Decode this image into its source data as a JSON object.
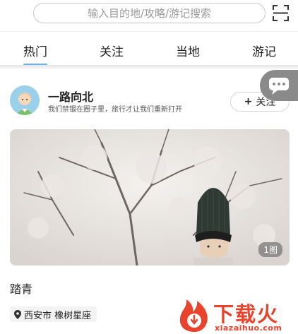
{
  "search": {
    "placeholder": "输入目的地/攻略/游记搜索",
    "icon": "scan-icon"
  },
  "tabs": [
    {
      "label": "热门",
      "active": true
    },
    {
      "label": "关注",
      "active": false
    },
    {
      "label": "当地",
      "active": false
    },
    {
      "label": "游记",
      "active": false
    }
  ],
  "post": {
    "username": "一路向北",
    "signature": "我们禁锢在圈子里，旅行才让我们重新打开",
    "follow_label": "关注",
    "follow_plus": "+",
    "image_count": "1图",
    "title": "踏青",
    "location": "西安市 橡树星座"
  },
  "watermark": {
    "title": "下载火",
    "subtitle": "xiazaihuo.com"
  },
  "colors": {
    "accent": "#6bb5e6",
    "brand_red": "#e8432c"
  }
}
